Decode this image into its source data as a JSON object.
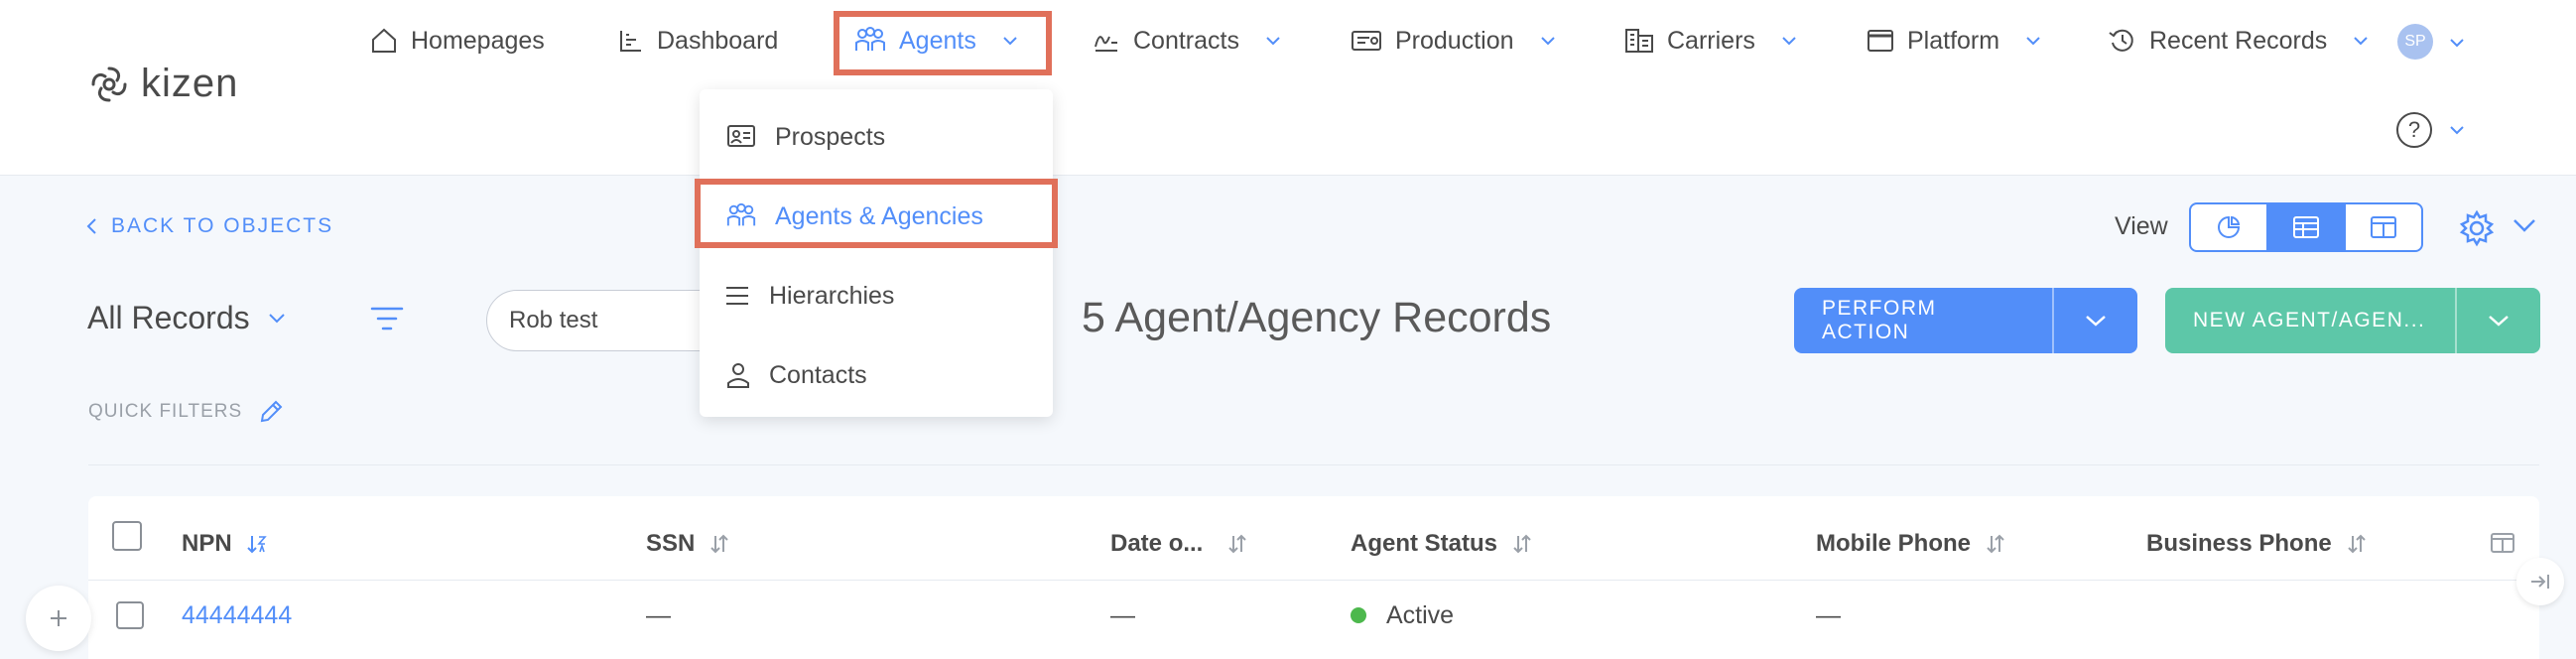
{
  "brand": {
    "name": "kizen"
  },
  "nav": {
    "items": [
      {
        "label": "Homepages",
        "icon": "home-icon"
      },
      {
        "label": "Dashboard",
        "icon": "dashboard-icon"
      },
      {
        "label": "Agents",
        "icon": "people-icon",
        "active": true
      },
      {
        "label": "Contracts",
        "icon": "signature-icon"
      },
      {
        "label": "Production",
        "icon": "money-icon"
      },
      {
        "label": "Carriers",
        "icon": "building-icon"
      },
      {
        "label": "Platform",
        "icon": "window-icon"
      },
      {
        "label": "Recent Records",
        "icon": "history-icon"
      }
    ],
    "avatar_initials": "SP",
    "help_symbol": "?"
  },
  "agents_dropdown": {
    "items": [
      {
        "label": "Prospects",
        "icon": "prospects-icon"
      },
      {
        "label": "Agents & Agencies",
        "icon": "people-icon",
        "active": true
      },
      {
        "label": "Hierarchies",
        "icon": "list-icon"
      },
      {
        "label": "Contacts",
        "icon": "person-icon"
      }
    ]
  },
  "toolbar": {
    "back_label": "BACK TO OBJECTS",
    "view_label": "View",
    "views": [
      "chart-view",
      "table-view",
      "board-view"
    ],
    "active_view": "table-view",
    "records_filter_label": "All Records",
    "search_value": "Rob test",
    "record_count_text": "5 Agent/Agency Records",
    "perform_action_label": "PERFORM ACTION",
    "new_record_label": "NEW AGENT/AGEN..."
  },
  "quick_filters": {
    "label": "QUICK FILTERS"
  },
  "table": {
    "columns": [
      "NPN",
      "SSN",
      "Date o...",
      "Agent Status",
      "Mobile Phone",
      "Business Phone"
    ],
    "rows": [
      {
        "npn": "44444444",
        "ssn": "—",
        "date": "—",
        "status": "Active",
        "mobile": "—",
        "business": ""
      }
    ]
  },
  "colors": {
    "accent": "#528ef9",
    "success": "#5dc7a8",
    "highlight": "#e0705a",
    "status_active": "#4db84d"
  }
}
